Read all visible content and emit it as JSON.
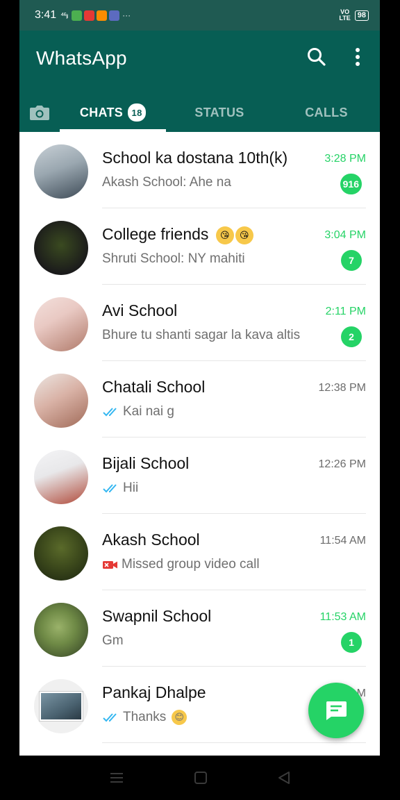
{
  "status_bar": {
    "time": "3:41",
    "signal": "⁴⁶ᵢₗ",
    "notif_colors": [
      "#4caf50",
      "#e53935",
      "#fb8c00",
      "#5c6bc0"
    ],
    "more": "···",
    "volte_top": "VO",
    "volte_bottom": "LTE",
    "battery": "98"
  },
  "header": {
    "title": "WhatsApp",
    "search_icon": "search-icon",
    "menu_icon": "more-vert-icon"
  },
  "tabs": {
    "camera_icon": "camera-icon",
    "chats": "CHATS",
    "chats_badge": "18",
    "status": "STATUS",
    "calls": "CALLS"
  },
  "chats": [
    {
      "name": "School ka dostana 10th(k)",
      "time": "3:28 PM",
      "message": "Akash School: Ahe na",
      "unread": "916",
      "time_unread": true,
      "ticks": false,
      "avatar_colors": [
        "#9aa7b0",
        "#3d4a56"
      ]
    },
    {
      "name": "College friends",
      "name_emojis": [
        "😘",
        "😘"
      ],
      "time": "3:04 PM",
      "message": "Shruti School: NY mahiti",
      "unread": "7",
      "time_unread": true,
      "ticks": false,
      "avatar_colors": [
        "#1b1b1b",
        "#3a4a20"
      ]
    },
    {
      "name": "Avi School",
      "time": "2:11 PM",
      "message": "Bhure tu shanti sagar la kava altis",
      "unread": "2",
      "time_unread": true,
      "ticks": false,
      "avatar_colors": [
        "#e9c9c3",
        "#b07a6a"
      ]
    },
    {
      "name": "Chatali School",
      "time": "12:38 PM",
      "message": "Kai nai g",
      "unread": "",
      "time_unread": false,
      "ticks": true,
      "avatar_colors": [
        "#d9b2a6",
        "#a06a58"
      ]
    },
    {
      "name": "Bijali School",
      "time": "12:26 PM",
      "message": "Hii",
      "unread": "",
      "time_unread": false,
      "ticks": true,
      "avatar_colors": [
        "#e8e8ea",
        "#b04a3a"
      ]
    },
    {
      "name": "Akash School",
      "time": "11:54 AM",
      "message": "Missed group video call",
      "unread": "",
      "time_unread": false,
      "ticks": false,
      "missed_video": true,
      "avatar_colors": [
        "#3d4a1c",
        "#1b2410"
      ]
    },
    {
      "name": "Swapnil School",
      "time": "11:53 AM",
      "message": "Gm",
      "unread": "1",
      "time_unread": true,
      "ticks": false,
      "avatar_colors": [
        "#6f8a46",
        "#2e3c22"
      ]
    },
    {
      "name": "Pankaj Dhalpe",
      "time": "M",
      "message": "Thanks",
      "message_emoji": "😊",
      "unread": "",
      "time_unread": false,
      "ticks": true,
      "avatar_colors": [
        "#f0f0f0",
        "#4a6270"
      ]
    }
  ],
  "fab_icon": "new-chat-icon",
  "nav": {
    "menu_icon": "recents-icon",
    "home_icon": "home-icon",
    "back_icon": "back-icon"
  },
  "colors": {
    "primary": "#075e54",
    "accent": "#25d366",
    "tick": "#34b7f1",
    "missed": "#e53935"
  }
}
